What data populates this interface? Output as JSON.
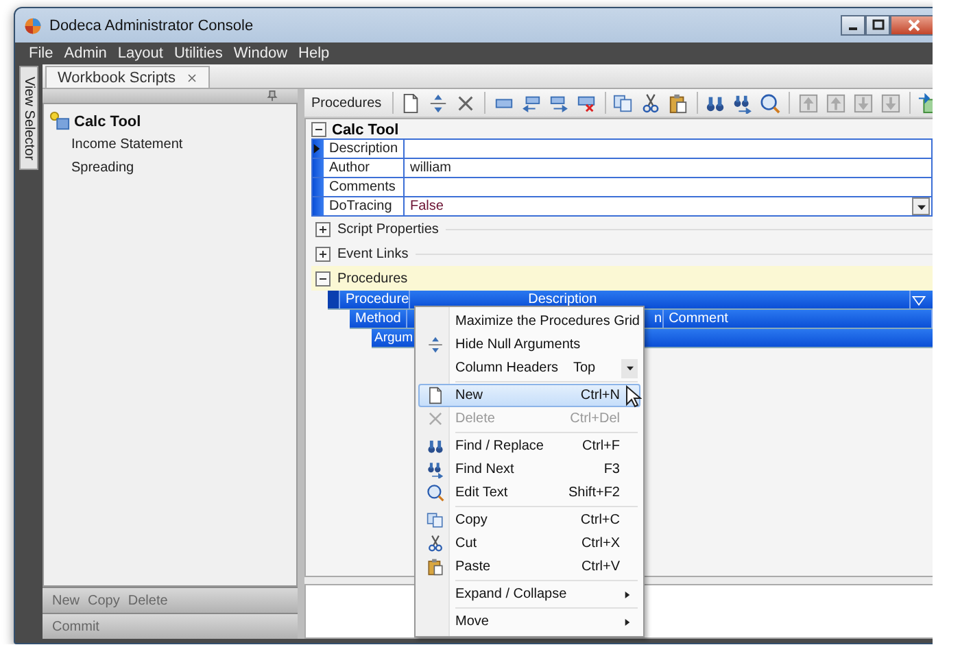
{
  "window": {
    "title": "Dodeca Administrator Console"
  },
  "menu_bar": [
    "File",
    "Admin",
    "Layout",
    "Utilities",
    "Window",
    "Help"
  ],
  "side_tab": {
    "label": "View Selector"
  },
  "tabs": [
    {
      "label": "Workbook Scripts",
      "selected": true
    }
  ],
  "tree": [
    {
      "label": "Calc Tool",
      "children": [
        {
          "label": "Income Statement"
        },
        {
          "label": "Spreading"
        }
      ]
    }
  ],
  "left_actions": [
    "New",
    "Copy",
    "Delete"
  ],
  "commit": "Commit",
  "toolbar": {
    "label": "Procedures"
  },
  "script_group": {
    "title": "Calc Tool",
    "expanded": true
  },
  "properties": [
    {
      "name": "Description",
      "selected": true,
      "kind": "text"
    },
    {
      "name": "Author",
      "value": "william",
      "selected": false,
      "kind": "text"
    },
    {
      "name": "Comments",
      "selected": false,
      "kind": "text"
    },
    {
      "name": "DoTracing",
      "value": "False",
      "selected": false,
      "kind": "dropdown"
    }
  ],
  "sections": [
    {
      "label": "Script Properties",
      "expanded": false,
      "selected": false
    },
    {
      "label": "Event Links",
      "expanded": false,
      "selected": false
    },
    {
      "label": "Procedures",
      "expanded": true,
      "selected": true
    }
  ],
  "procedures_grid": {
    "bands": [
      {
        "columns": [
          "Procedure",
          "Description"
        ]
      },
      {
        "columns": [
          "Method",
          "n",
          "Comment"
        ]
      },
      {
        "columns": [
          "Argum"
        ]
      }
    ]
  },
  "context_menu": [
    {
      "kind": "item",
      "label": "Maximize the Procedures Grid",
      "selected": false,
      "disabled": false
    },
    {
      "kind": "item",
      "label": "Hide Null Arguments",
      "selected": false,
      "disabled": false
    },
    {
      "kind": "option",
      "label": "Column Headers",
      "value": "Top",
      "selected": false
    },
    {
      "kind": "separator"
    },
    {
      "kind": "item",
      "label": "New",
      "shortcut": "Ctrl+N",
      "selected": true,
      "disabled": false
    },
    {
      "kind": "item",
      "label": "Delete",
      "shortcut": "Ctrl+Del",
      "selected": false,
      "disabled": true
    },
    {
      "kind": "separator"
    },
    {
      "kind": "item",
      "label": "Find / Replace",
      "shortcut": "Ctrl+F",
      "selected": false,
      "disabled": false
    },
    {
      "kind": "item",
      "label": "Find Next",
      "shortcut": "F3",
      "selected": false,
      "disabled": false
    },
    {
      "kind": "item",
      "label": "Edit Text",
      "shortcut": "Shift+F2",
      "selected": false,
      "disabled": false
    },
    {
      "kind": "separator"
    },
    {
      "kind": "item",
      "label": "Copy",
      "shortcut": "Ctrl+C",
      "selected": false,
      "disabled": false
    },
    {
      "kind": "item",
      "label": "Cut",
      "shortcut": "Ctrl+X",
      "selected": false,
      "disabled": false
    },
    {
      "kind": "item",
      "label": "Paste",
      "shortcut": "Ctrl+V",
      "selected": false,
      "disabled": false
    },
    {
      "kind": "separator"
    },
    {
      "kind": "submenu",
      "label": "Expand / Collapse",
      "selected": false
    },
    {
      "kind": "separator"
    },
    {
      "kind": "submenu",
      "label": "Move",
      "selected": false
    }
  ]
}
